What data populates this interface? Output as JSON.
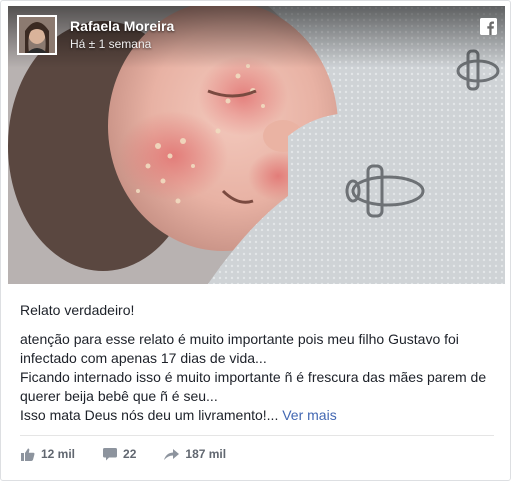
{
  "post": {
    "author": "Rafaela Moreira",
    "time": "Há ± 1 semana",
    "headline": "Relato verdadeiro!",
    "body_lines": [
      "atenção para esse relato é muito importante pois meu filho Gustavo foi",
      "infectado com apenas 17 dias de vida...",
      "Ficando internado isso é muito importante ñ é frescura das mães parem de",
      "querer beija bebê que ñ é seu...",
      "Isso mata Deus nós deu um livramento!..."
    ],
    "see_more": "Ver mais"
  },
  "stats": {
    "likes": "12 mil",
    "comments": "22",
    "shares": "187 mil"
  },
  "icons": {
    "brand": "facebook-icon",
    "like": "thumbs-up-icon",
    "comment": "comment-icon",
    "share": "share-icon"
  },
  "colors": {
    "link": "#4267b2",
    "meta_text": "#616770",
    "body_text": "#1d2129"
  }
}
